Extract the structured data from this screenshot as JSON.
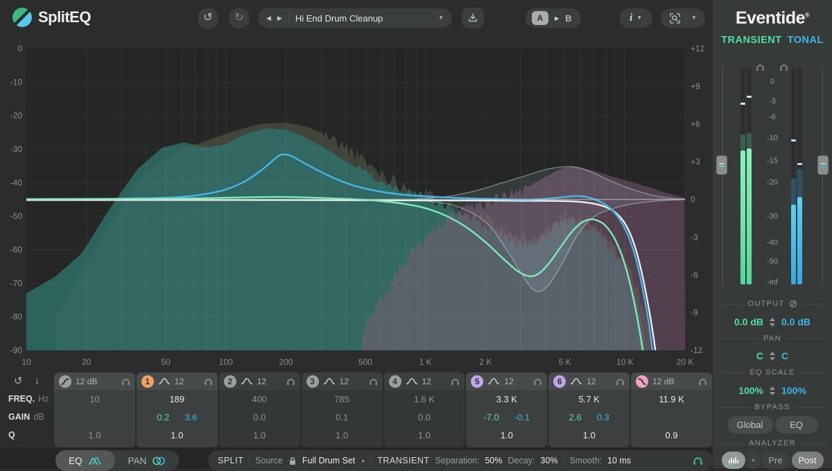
{
  "icons": {
    "undo": "↺",
    "redo": "↻",
    "prev": "◀",
    "next": "▶",
    "down": "▼",
    "up": "▲"
  },
  "topbar": {
    "app_name": "SplitEQ",
    "preset": "Hi End Drum Cleanup",
    "ab_a": "A",
    "ab_b": "B",
    "info": "i"
  },
  "right_panel": {
    "brand": "Eventide",
    "brand_mark": "®",
    "streams": {
      "transient": "TRANSIENT",
      "tonal": "TONAL"
    },
    "meter": {
      "ticks": [
        {
          "label": "0",
          "db": 0
        },
        {
          "label": "-3",
          "db": -3
        },
        {
          "label": "-6",
          "db": -6
        },
        {
          "label": "-10",
          "db": -10
        },
        {
          "label": "-15",
          "db": -15
        },
        {
          "label": "-20",
          "db": -20
        },
        {
          "label": "-30",
          "db": -30
        },
        {
          "label": "-40",
          "db": -40
        },
        {
          "label": "-50",
          "db": -50
        },
        {
          "label": "-inf",
          "db": -60
        }
      ],
      "transient": {
        "levels_db": [
          -12.7,
          -12.3
        ],
        "peaks_db": [
          -3.4,
          -2.2
        ],
        "ghosts_db": [
          -9.3,
          -9.0
        ],
        "trim_db": -16,
        "color_top": "#8bf2bd",
        "color_bottom": "#55d79a",
        "peak_color": "#c2f7da",
        "trim_mark": "#53dda1"
      },
      "tonal": {
        "levels_db": [
          -26.5,
          -24.3
        ],
        "peaks_db": [
          -10.5,
          -15.6
        ],
        "ghosts_db": [
          -19.0,
          -17.0
        ],
        "trim_db": -16,
        "color_top": "#5ecdf4",
        "color_bottom": "#38a9e0",
        "peak_color": "#a8e2f8",
        "trim_mark": "#3db6e8"
      }
    },
    "output": {
      "label": "OUTPUT",
      "transient": "0.0 dB",
      "tonal": "0.0 dB"
    },
    "pan": {
      "label": "PAN",
      "transient": "C",
      "tonal": "C"
    },
    "eq_scale": {
      "label": "EQ SCALE",
      "transient": "100%",
      "tonal": "100%"
    },
    "bypass": {
      "label": "BYPASS",
      "global": "Global",
      "eq": "EQ"
    },
    "analyzer": {
      "label": "ANALYZER",
      "pre": "Pre",
      "post": "Post"
    }
  },
  "band_table": {
    "rows": [
      {
        "name": "FREQ.",
        "unit": "Hz"
      },
      {
        "name": "GAIN",
        "unit": "dB"
      },
      {
        "name": "Q",
        "unit": ""
      }
    ]
  },
  "bands": [
    {
      "id": "hp",
      "type": "highpass",
      "slope": "12 dB",
      "freq": "10",
      "gain": "",
      "q": "1.0",
      "active": true,
      "hot": false,
      "color": "#9b9f9e"
    },
    {
      "id": "1",
      "type": "bell",
      "slope": "12",
      "freq": "189",
      "gain_t": "0.2",
      "gain_n": "3.6",
      "q": "1.0",
      "active": true,
      "hot": true,
      "color": "#f0a360"
    },
    {
      "id": "2",
      "type": "bell",
      "slope": "12",
      "freq": "400",
      "gain": "0.0",
      "q": "1.0",
      "active": false,
      "hot": false,
      "color": "#9b9f9e"
    },
    {
      "id": "3",
      "type": "bell",
      "slope": "12",
      "freq": "785",
      "gain": "0.1",
      "q": "1.0",
      "active": false,
      "hot": false,
      "color": "#9b9f9e"
    },
    {
      "id": "4",
      "type": "bell",
      "slope": "12",
      "freq": "1.6 K",
      "gain": "0.0",
      "q": "1.0",
      "active": false,
      "hot": false,
      "color": "#9b9f9e"
    },
    {
      "id": "5",
      "type": "bell",
      "slope": "12",
      "freq": "3.3 K",
      "gain_t": "-7.0",
      "gain_n": "-0.1",
      "q": "1.0",
      "active": true,
      "hot": true,
      "color": "#c6a3ee"
    },
    {
      "id": "6",
      "type": "bell",
      "slope": "12",
      "freq": "5.7 K",
      "gain_t": "2.6",
      "gain_n": "0.3",
      "q": "1.0",
      "active": true,
      "hot": true,
      "color": "#c6a3ee"
    },
    {
      "id": "lp",
      "type": "lowpass",
      "slope": "12 dB",
      "freq": "11.9 K",
      "gain": "",
      "q": "0.9",
      "active": true,
      "hot": true,
      "color": "#f2a2c1"
    }
  ],
  "bottombar": {
    "tab_eq": "EQ",
    "tab_pan": "PAN",
    "split_label": "SPLIT",
    "source_label": "Source",
    "source_value": "Full Drum Set",
    "transient_label": "TRANSIENT",
    "separation_label": "Separation:",
    "separation_value": "50%",
    "decay_label": "Decay:",
    "decay_value": "30%",
    "smooth_label": "Smooth:",
    "smooth_value": "10 ms"
  },
  "chart_data": {
    "type": "line",
    "title": "SplitEQ transient/tonal frequency response with spectrum analyzer",
    "x_axis": {
      "scale": "log",
      "min": 10,
      "max": 20000,
      "ticks": [
        {
          "v": 10,
          "label": "10"
        },
        {
          "v": 20,
          "label": "20"
        },
        {
          "v": 50,
          "label": "50"
        },
        {
          "v": 100,
          "label": "100"
        },
        {
          "v": 200,
          "label": "200"
        },
        {
          "v": 500,
          "label": "500"
        },
        {
          "v": 1000,
          "label": "1 K"
        },
        {
          "v": 2000,
          "label": "2 K"
        },
        {
          "v": 5000,
          "label": "5 K"
        },
        {
          "v": 10000,
          "label": "10 K"
        },
        {
          "v": 20000,
          "label": "20 K"
        }
      ]
    },
    "y_spectrum_axis": {
      "min": -90,
      "max": 0,
      "ticks": [
        {
          "label": "0",
          "v": 0
        },
        {
          "label": "-10",
          "v": -10
        },
        {
          "label": "-20",
          "v": -20
        },
        {
          "label": "-30",
          "v": -30
        },
        {
          "label": "-40",
          "v": -40
        },
        {
          "label": "-50",
          "v": -50
        },
        {
          "label": "-60",
          "v": -60
        },
        {
          "label": "-70",
          "v": -70
        },
        {
          "label": "-80",
          "v": -80
        },
        {
          "label": "-90",
          "v": -90
        }
      ]
    },
    "y_gain_axis": {
      "min": -12,
      "max": 12,
      "ticks": [
        {
          "label": "+12",
          "v": 12
        },
        {
          "label": "+9",
          "v": 9
        },
        {
          "label": "+6",
          "v": 6
        },
        {
          "label": "+3",
          "v": 3
        },
        {
          "label": "0",
          "v": 0
        },
        {
          "label": "-3",
          "v": -3
        },
        {
          "label": "-6",
          "v": -6
        },
        {
          "label": "-9",
          "v": -9
        },
        {
          "label": "-12",
          "v": -12
        }
      ]
    },
    "zero_line": {
      "color": "rgba(198,214,210,0.6)"
    },
    "spectra": [
      {
        "name": "transient-spectrum-ghost",
        "fill": "rgba(105,118,88,0.40)",
        "jag": [
          300,
          13000
        ],
        "jag_amp": 2.2,
        "points": [
          [
            14,
            -80
          ],
          [
            20,
            -64
          ],
          [
            28,
            -50
          ],
          [
            38,
            -38
          ],
          [
            55,
            -31
          ],
          [
            80,
            -27.5
          ],
          [
            110,
            -24.5
          ],
          [
            150,
            -22.5
          ],
          [
            200,
            -22
          ],
          [
            260,
            -23.5
          ],
          [
            330,
            -26.5
          ],
          [
            430,
            -31
          ],
          [
            560,
            -36
          ],
          [
            720,
            -40
          ],
          [
            900,
            -42.5
          ],
          [
            1200,
            -45.5
          ],
          [
            1600,
            -48.5
          ],
          [
            2100,
            -52
          ],
          [
            2700,
            -56
          ],
          [
            3400,
            -57.5
          ],
          [
            4100,
            -54
          ],
          [
            5000,
            -49.5
          ],
          [
            6000,
            -50.5
          ],
          [
            7200,
            -53.5
          ],
          [
            8500,
            -58
          ],
          [
            10000,
            -63
          ],
          [
            11500,
            -71
          ],
          [
            12800,
            -80
          ],
          [
            13600,
            -90
          ]
        ]
      },
      {
        "name": "transient-spectrum",
        "fill": "rgba(47,112,106,0.82)",
        "jag": [
          450,
          12500
        ],
        "jag_amp": 1.6,
        "points": [
          [
            10,
            -73
          ],
          [
            14,
            -68
          ],
          [
            19,
            -61
          ],
          [
            26,
            -48
          ],
          [
            36,
            -36
          ],
          [
            48,
            -29.5
          ],
          [
            62,
            -28
          ],
          [
            80,
            -29.5
          ],
          [
            100,
            -28.5
          ],
          [
            125,
            -25.5
          ],
          [
            160,
            -23.8
          ],
          [
            200,
            -24.2
          ],
          [
            250,
            -26.5
          ],
          [
            320,
            -30
          ],
          [
            420,
            -34.5
          ],
          [
            550,
            -38.5
          ],
          [
            700,
            -41.5
          ],
          [
            900,
            -43.5
          ],
          [
            1150,
            -46
          ],
          [
            1500,
            -48.5
          ],
          [
            1950,
            -52.5
          ],
          [
            2500,
            -56.5
          ],
          [
            3100,
            -58.8
          ],
          [
            3800,
            -57
          ],
          [
            4600,
            -53
          ],
          [
            5400,
            -51.5
          ],
          [
            6200,
            -52.5
          ],
          [
            7200,
            -55
          ],
          [
            8200,
            -58.5
          ],
          [
            9200,
            -62.5
          ],
          [
            10200,
            -67
          ],
          [
            11000,
            -72
          ],
          [
            11700,
            -78
          ],
          [
            12300,
            -85
          ],
          [
            12700,
            -90
          ]
        ]
      },
      {
        "name": "tonal-spectrum",
        "fill": "rgba(128,90,118,0.50)",
        "jag": [
          480,
          3200
        ],
        "jag_amp": 2.2,
        "points": [
          [
            480,
            -85
          ],
          [
            600,
            -75
          ],
          [
            750,
            -66
          ],
          [
            950,
            -58
          ],
          [
            1200,
            -52
          ],
          [
            1500,
            -49
          ],
          [
            1900,
            -46.5
          ],
          [
            2400,
            -44.5
          ],
          [
            3000,
            -42.5
          ],
          [
            3800,
            -39
          ],
          [
            4700,
            -36
          ],
          [
            5400,
            -35
          ],
          [
            6300,
            -35.8
          ],
          [
            7500,
            -37
          ],
          [
            9000,
            -38.5
          ],
          [
            11000,
            -40
          ],
          [
            13500,
            -41.5
          ],
          [
            16000,
            -43
          ],
          [
            20000,
            -44.5
          ]
        ]
      }
    ],
    "region": {
      "stroke": "rgba(200,222,220,0.5)",
      "fill": "rgba(208,226,234,0.10)",
      "upper": [
        [
          900,
          0.02
        ],
        [
          1300,
          0.25
        ],
        [
          1800,
          0.7
        ],
        [
          2400,
          1.3
        ],
        [
          3200,
          1.9
        ],
        [
          4200,
          2.45
        ],
        [
          5400,
          2.6
        ],
        [
          6500,
          2.3
        ],
        [
          8000,
          1.65
        ],
        [
          10000,
          1.0
        ],
        [
          12500,
          0.5
        ],
        [
          15000,
          0.22
        ],
        [
          17500,
          0.08
        ],
        [
          20000,
          0.02
        ]
      ],
      "lower": [
        [
          900,
          -0.03
        ],
        [
          1400,
          -0.5
        ],
        [
          2000,
          -1.8
        ],
        [
          2600,
          -4.2
        ],
        [
          3200,
          -6.5
        ],
        [
          3600,
          -7.3
        ],
        [
          4100,
          -6.9
        ],
        [
          4800,
          -5.2
        ],
        [
          5600,
          -3.2
        ],
        [
          6400,
          -1.9
        ],
        [
          7400,
          -1.15
        ],
        [
          8800,
          -0.7
        ],
        [
          10500,
          -0.4
        ],
        [
          13000,
          -0.2
        ],
        [
          16000,
          -0.07
        ],
        [
          20000,
          0
        ]
      ]
    },
    "curves": [
      {
        "name": "combined-eq-curve",
        "color": "#e9edec",
        "width": 2.4,
        "points": [
          [
            10,
            -0.05
          ],
          [
            200,
            -0.05
          ],
          [
            1000,
            -0.08
          ],
          [
            2500,
            -0.1
          ],
          [
            4500,
            -0.12
          ],
          [
            6000,
            -0.2
          ],
          [
            7500,
            -0.45
          ],
          [
            8700,
            -0.9
          ],
          [
            9800,
            -1.7
          ],
          [
            10800,
            -3.0
          ],
          [
            11800,
            -5.0
          ],
          [
            12800,
            -7.6
          ],
          [
            13800,
            -10.6
          ],
          [
            14800,
            -14
          ]
        ]
      },
      {
        "name": "tonal-eq-curve",
        "color": "#43b7ec",
        "width": 2.4,
        "points": [
          [
            10,
            0.02
          ],
          [
            30,
            0.06
          ],
          [
            60,
            0.2
          ],
          [
            90,
            0.6
          ],
          [
            120,
            1.3
          ],
          [
            150,
            2.3
          ],
          [
            175,
            3.2
          ],
          [
            189,
            3.55
          ],
          [
            210,
            3.5
          ],
          [
            240,
            3.0
          ],
          [
            290,
            2.3
          ],
          [
            360,
            1.6
          ],
          [
            450,
            1.05
          ],
          [
            580,
            0.65
          ],
          [
            750,
            0.4
          ],
          [
            1000,
            0.25
          ],
          [
            1400,
            0.13
          ],
          [
            2000,
            0.05
          ],
          [
            2700,
            0.0
          ],
          [
            3300,
            -0.02
          ],
          [
            4200,
            0.08
          ],
          [
            5000,
            0.2
          ],
          [
            5700,
            0.27
          ],
          [
            6400,
            0.2
          ],
          [
            7200,
            -0.05
          ],
          [
            8200,
            -0.55
          ],
          [
            9200,
            -1.35
          ],
          [
            10200,
            -2.6
          ],
          [
            11200,
            -4.4
          ],
          [
            12200,
            -6.9
          ],
          [
            13200,
            -10
          ],
          [
            14200,
            -13.8
          ]
        ]
      },
      {
        "name": "transient-eq-curve",
        "color": "#7cebb5",
        "width": 2.4,
        "points": [
          [
            10,
            0.02
          ],
          [
            50,
            0.06
          ],
          [
            90,
            0.12
          ],
          [
            140,
            0.18
          ],
          [
            189,
            0.2
          ],
          [
            250,
            0.16
          ],
          [
            350,
            0.08
          ],
          [
            500,
            -0.04
          ],
          [
            700,
            -0.25
          ],
          [
            950,
            -0.6
          ],
          [
            1250,
            -1.25
          ],
          [
            1600,
            -2.2
          ],
          [
            2000,
            -3.4
          ],
          [
            2450,
            -4.7
          ],
          [
            2900,
            -5.7
          ],
          [
            3300,
            -6.1
          ],
          [
            3700,
            -5.9
          ],
          [
            4200,
            -5.0
          ],
          [
            4800,
            -3.7
          ],
          [
            5400,
            -2.6
          ],
          [
            6000,
            -1.9
          ],
          [
            6600,
            -1.6
          ],
          [
            7200,
            -1.65
          ],
          [
            8000,
            -2.1
          ],
          [
            9000,
            -3.3
          ],
          [
            10000,
            -5.2
          ],
          [
            11000,
            -7.8
          ],
          [
            12000,
            -11
          ],
          [
            12800,
            -14
          ]
        ]
      }
    ]
  }
}
